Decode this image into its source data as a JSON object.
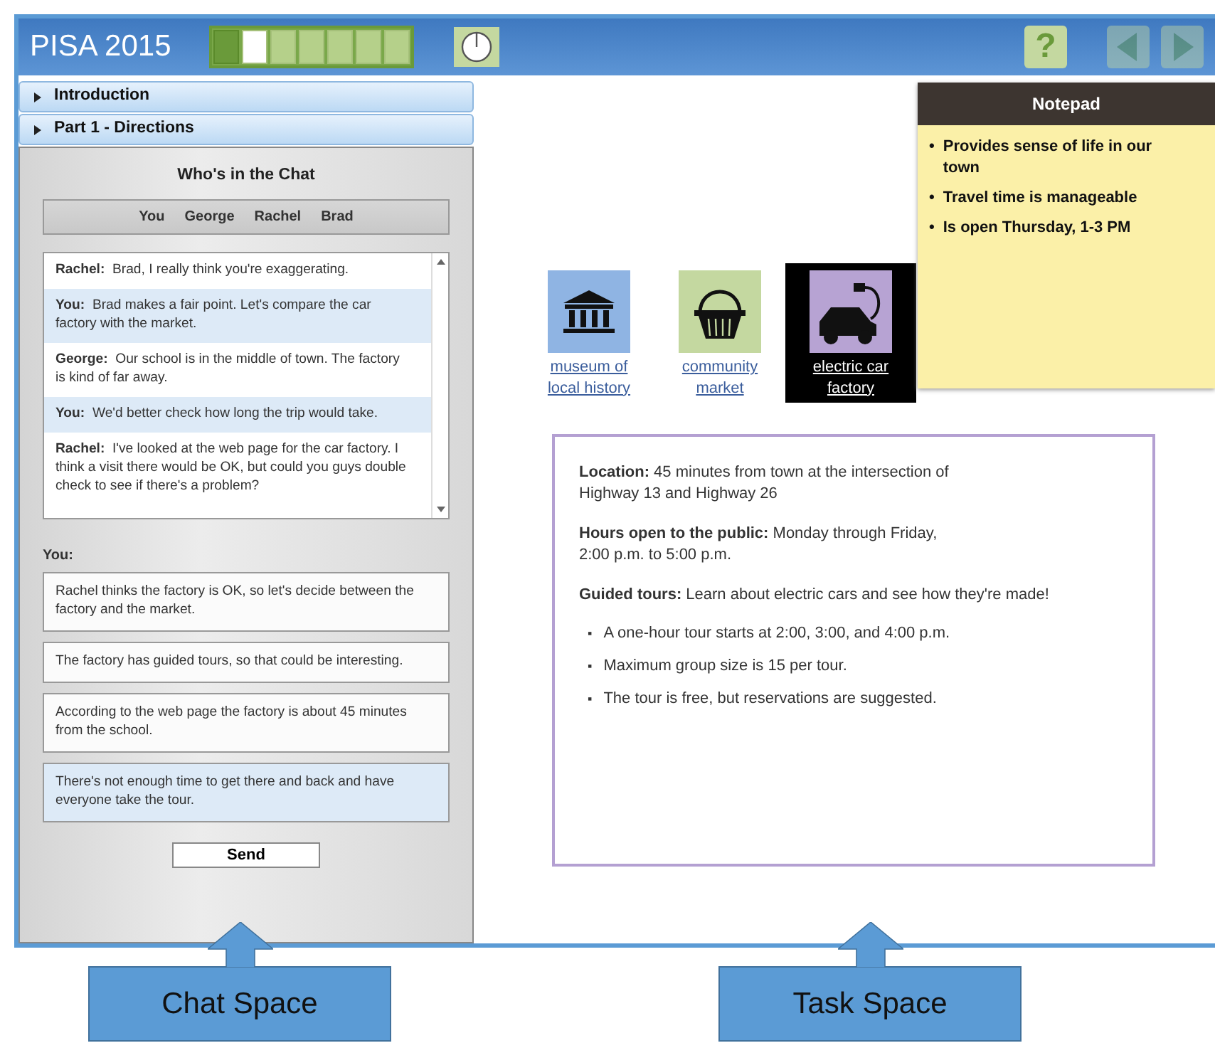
{
  "header": {
    "title": "PISA 2015",
    "progress": [
      {
        "completed": true,
        "selected": false
      },
      {
        "completed": false,
        "selected": true
      },
      {
        "completed": false,
        "selected": false
      },
      {
        "completed": false,
        "selected": false
      },
      {
        "completed": false,
        "selected": false
      },
      {
        "completed": false,
        "selected": false
      },
      {
        "completed": false,
        "selected": false
      }
    ],
    "help": "?",
    "nav": [
      {
        "kind": "back",
        "disabled": true
      },
      {
        "kind": "forward",
        "disabled": true
      }
    ]
  },
  "sections": [
    {
      "label": "Introduction",
      "expanded": false
    },
    {
      "label": "Part 1 - Directions",
      "expanded": false
    }
  ],
  "chat": {
    "title": "Who's in the Chat",
    "participants": [
      "You",
      "George",
      "Rachel",
      "Brad"
    ],
    "messages": [
      {
        "speaker": "Rachel:",
        "text": "Brad, I really think you're exaggerating.",
        "highlighted": false
      },
      {
        "speaker": "You:",
        "text": "Brad makes a fair point. Let's compare the car factory with the market.",
        "highlighted": true
      },
      {
        "speaker": "George:",
        "text": "Our school is in the middle of town. The factory is kind of far away.",
        "highlighted": false
      },
      {
        "speaker": "You:",
        "text": "We'd better check how long the trip would take.",
        "highlighted": true
      },
      {
        "speaker": "Rachel:",
        "text": "I've looked at the web page for the car factory. I think a visit there would be OK, but could you guys double check to see if there's a problem?",
        "highlighted": false
      }
    ],
    "reply_label": "You:",
    "options": [
      {
        "text": "Rachel thinks the factory is OK, so let's decide between the factory and the market.",
        "selected": false
      },
      {
        "text": "The factory has guided tours, so that could be interesting.",
        "selected": false
      },
      {
        "text": "According to the web page the factory is about 45 minutes from the school.",
        "selected": false
      },
      {
        "text": "There's not enough time to get there and back and have everyone take the tour.",
        "selected": true
      }
    ],
    "send": "Send"
  },
  "places": [
    {
      "kind": "museum",
      "label": "museum of local history",
      "color": "#8fb4e3",
      "selected": false
    },
    {
      "kind": "basket",
      "label": "community market",
      "color": "#c4d8a0",
      "selected": false
    },
    {
      "kind": "car",
      "label": "electric car factory",
      "color": "#b7a3d3",
      "selected": true
    }
  ],
  "notepad": {
    "title": "Notepad",
    "bullet": "•",
    "items": [
      "Provides sense of life in our town",
      "Travel time is manageable",
      "Is open Thursday, 1-3 PM"
    ]
  },
  "info": {
    "paragraphs": [
      "**Location:** 45 minutes from town at the intersection of\nHighway 13 and Highway 26",
      "**Hours open to the public:** Monday through Friday,\n2:00 p.m. to 5:00 p.m.",
      "**Guided tours:** Learn about electric cars and see how they're made!"
    ],
    "bullet": "▪",
    "bullets": [
      "A one-hour tour starts at 2:00, 3:00, and 4:00 p.m.",
      "Maximum group size is 15 per tour.",
      "The tour is free, but reservations are suggested."
    ]
  },
  "callouts": [
    "Chat Space",
    "Task Space"
  ]
}
